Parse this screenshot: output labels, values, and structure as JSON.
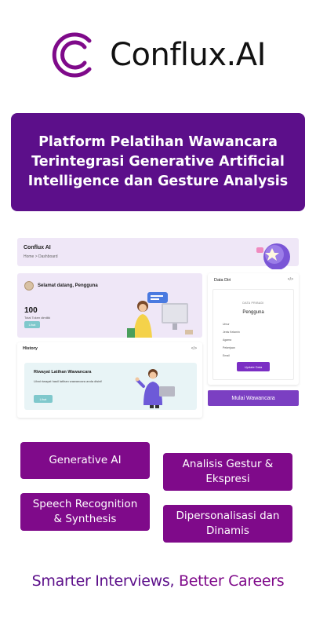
{
  "brand": {
    "name": "Conflux.AI",
    "logo_icon": "conflux-c-logo-icon",
    "color": "#7f0a8a"
  },
  "hero": {
    "line1": "Platform Pelatihan Wawancara",
    "line2": "Terintegrasi Generative Artificial",
    "line3": "Intelligence dan Gesture Analysis",
    "color": "#5c0f8a"
  },
  "dashboard": {
    "brand": "Conflux AI",
    "breadcrumb": "Home  >  Dashboard",
    "welcome": {
      "text": "Selamat datang, Pengguna",
      "token_count": "100",
      "token_label": "Total Token dimiliki",
      "lihat_label": "Lihat"
    },
    "history": {
      "title": "History",
      "code_icon": "</>",
      "card_title": "Riwayat Latihan Wawancara",
      "card_desc": "Lihat riwayat hasil latihan wawancara anda disini!",
      "card_button": "Lihat"
    },
    "profile": {
      "title": "Data Diri",
      "eye_icon": "</>",
      "subtitle": "DATA PRIBADI",
      "name": "Pengguna",
      "fields": [
        "Umur",
        "Jenis Kelamin",
        "Agama",
        "Pekerjaan",
        "Email"
      ],
      "update_button": "Update Data"
    },
    "start_button": "Mulai Wawancara"
  },
  "features": [
    {
      "lines": [
        "Generative AI"
      ]
    },
    {
      "lines": [
        "Analisis Gestur &",
        "Ekspresi"
      ]
    },
    {
      "lines": [
        "Speech Recognition",
        "& Synthesis"
      ]
    },
    {
      "lines": [
        "Dipersonalisasi dan",
        "Dinamis"
      ]
    }
  ],
  "tagline": {
    "part1": "Smarter Interviews,",
    "part2": "Better Careers"
  }
}
